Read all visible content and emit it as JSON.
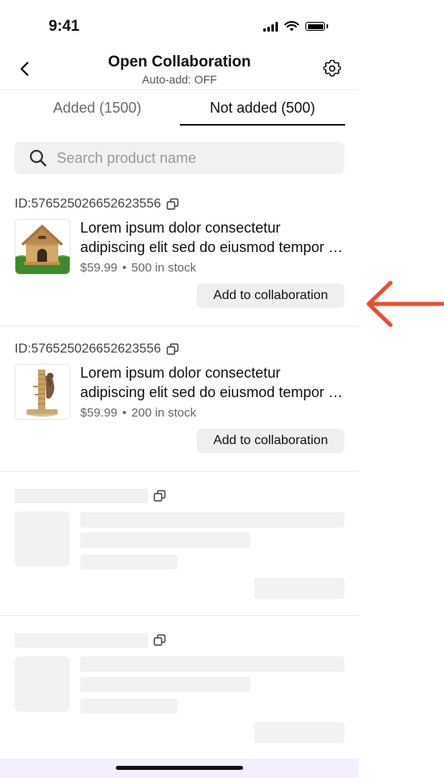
{
  "status_bar": {
    "time": "9:41"
  },
  "header": {
    "title": "Open Collaboration",
    "subtitle": "Auto-add: OFF"
  },
  "tabs": [
    {
      "label": "Added (1500)",
      "active": false
    },
    {
      "label": "Not added (500)",
      "active": true
    }
  ],
  "search": {
    "placeholder": "Search product name"
  },
  "products": [
    {
      "id_label": "ID:576525026652623556",
      "name_line1": "Lorem ipsum dolor consectetur",
      "name_line2": "adipiscing elit sed do eiusmod tempor incididunt",
      "price": "$59.99",
      "stock": "500 in stock",
      "button_label": "Add to collaboration",
      "image": "dog-house"
    },
    {
      "id_label": "ID:576525026652623556",
      "name_line1": "Lorem ipsum dolor consectetur",
      "name_line2": "adipiscing elit sed do eiusmod tempor incididunt",
      "price": "$59.99",
      "stock": "200 in stock",
      "button_label": "Add to collaboration",
      "image": "cat-scratching-post"
    }
  ],
  "annotation": {
    "arrow_color": "#ee4d2d"
  },
  "colors": {
    "accent": "#111111",
    "skeleton": "#f2f2f2",
    "bottom_bar": "#f4eefe"
  }
}
